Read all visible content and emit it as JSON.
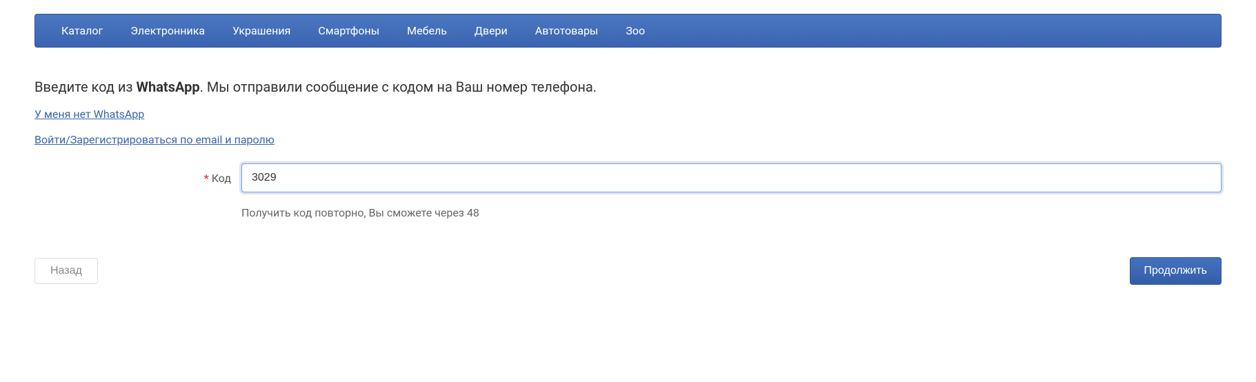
{
  "nav": {
    "items": [
      {
        "label": "Каталог"
      },
      {
        "label": "Электронника"
      },
      {
        "label": "Украшения"
      },
      {
        "label": "Смартфоны"
      },
      {
        "label": "Мебель"
      },
      {
        "label": "Двери"
      },
      {
        "label": "Автотовары"
      },
      {
        "label": "Зоо"
      }
    ]
  },
  "instruction": {
    "prefix": "Введите код из ",
    "bold": "WhatsApp",
    "suffix": ". Мы отправили сообщение с кодом на Ваш номер телефона."
  },
  "links": {
    "no_whatsapp": "У меня нет WhatsApp",
    "login_email": "Войти/Зарегистрироваться по email и паролю"
  },
  "form": {
    "required_mark": "*",
    "code_label": "Код",
    "code_value": "3029",
    "helper_text": "Получить код повторно, Вы сможете через 48"
  },
  "buttons": {
    "back": "Назад",
    "continue": "Продолжить"
  }
}
